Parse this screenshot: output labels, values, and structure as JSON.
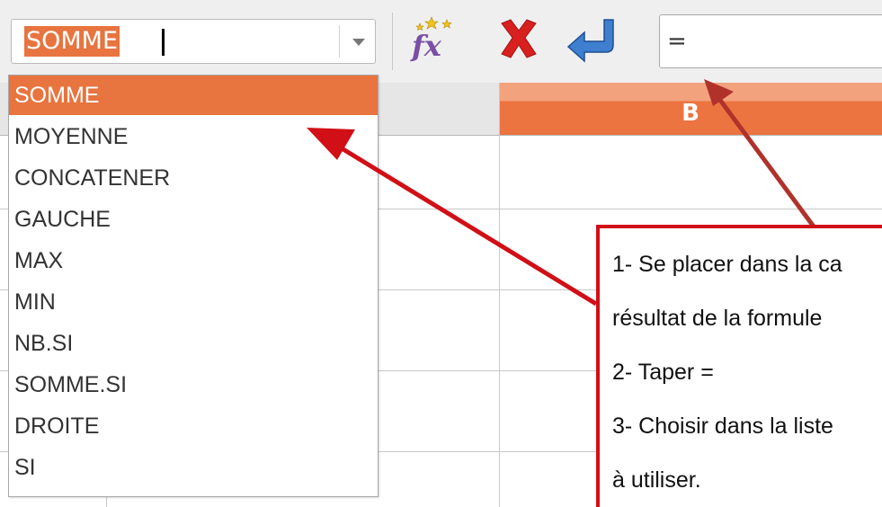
{
  "toolbar": {
    "name_box_value": "SOMME",
    "formula_value": "=",
    "fx_tooltip": "fx"
  },
  "grid": {
    "column_b_header": "B"
  },
  "function_list": {
    "items": [
      "SOMME",
      "MOYENNE",
      "CONCATENER",
      "GAUCHE",
      "MAX",
      "MIN",
      "NB.SI",
      "SOMME.SI",
      "DROITE",
      "SI"
    ],
    "selected_index": 0
  },
  "annotation": {
    "lines": [
      "1- Se placer dans la ca",
      "résultat de la formule",
      "2- Taper =",
      "3- Choisir dans la liste",
      "à utiliser."
    ],
    "color": "#d10f16"
  },
  "colors": {
    "accent": "#e8743f",
    "annotation": "#d10f16"
  }
}
